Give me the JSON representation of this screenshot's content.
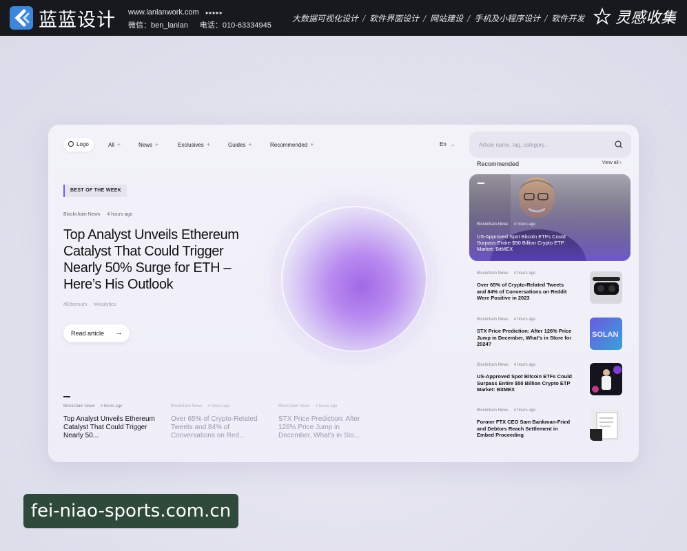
{
  "banner": {
    "brand_name": "蓝蓝设计",
    "website": "www.lanlanwork.com",
    "wechat": "微信：ben_lanlan",
    "phone": "电话：010-63334945",
    "services": [
      "大数据可视化设计",
      "软件界面设计",
      "网站建设",
      "手机及小程序设计",
      "软件开发"
    ],
    "separator": "/",
    "inspire": "灵感收集"
  },
  "nav": {
    "logo_label": "Logo",
    "items": [
      "All",
      "News",
      "Exclusives",
      "Guides",
      "Recommended"
    ],
    "plus": "+",
    "language": "En",
    "search_placeholder": "Article name, tag, category..."
  },
  "hero": {
    "badge": "BEST OF THE WEEK",
    "category": "Blockchain News",
    "time": "4 hours ago",
    "title": "Top Analyst Unveils Ethereum Catalyst That Could Trigger Nearly 50% Surge for ETH – Here’s His Outlook",
    "tags": [
      "#Ethereum",
      "#Analytics"
    ],
    "read_label": "Read article",
    "read_arrow": "→"
  },
  "bottom_articles": [
    {
      "category": "Blockchain News",
      "time": "4 hours ago",
      "title": "Top Analyst Unveils Ethereum Catalyst That Could Trigger Nearly 50..."
    },
    {
      "category": "Blockchain News",
      "time": "4 hours ago",
      "title": "Over 65% of Crypto-Related Tweets and 84% of Conversations on Red..."
    },
    {
      "category": "Blockchain News",
      "time": "4 hours ago",
      "title": "STX Price Prediction: After 126% Price Jump in December, What’s in Sto..."
    }
  ],
  "sidebar": {
    "heading": "Recommended",
    "view_all": "View all",
    "view_all_arrow": "›",
    "featured": {
      "category": "Blockchain News",
      "time": "4 hours ago",
      "title": "US-Approved Spot Bitcoin ETFs Could Surpass Entire $50 Billion Crypto ETP Market: BitMEX"
    },
    "items": [
      {
        "category": "Blockchain News",
        "time": "4 hours ago",
        "title": "Over 65% of Crypto-Related Tweets and 84% of Conversations on Reddit Were Positive in 2023",
        "thumb": "vr-headset"
      },
      {
        "category": "Blockchain News",
        "time": "4 hours ago",
        "title": "STX Price Prediction: After 126% Price Jump in December, What’s in Store for 2024?",
        "thumb": "solana"
      },
      {
        "category": "Blockchain News",
        "time": "4 hours ago",
        "title": "US-Approved Spot Bitcoin ETFs Could Surpass Entire $50 Billion Crypto ETP Market: BitMEX",
        "thumb": "speaker"
      },
      {
        "category": "Blockchain News",
        "time": "4 hours ago",
        "title": "Former FTX CEO Sam Bankman-Fried and Debtors Reach Settlement in Embed Proceeding",
        "thumb": "etf-document"
      }
    ],
    "thumb_solana_text": "SOLAN"
  },
  "watermark": "fei-niao-sports.com.cn",
  "colors": {
    "accent": "#6d5fd8",
    "banner_bg": "#17191f",
    "watermark_bg": "#2f4a3a"
  }
}
